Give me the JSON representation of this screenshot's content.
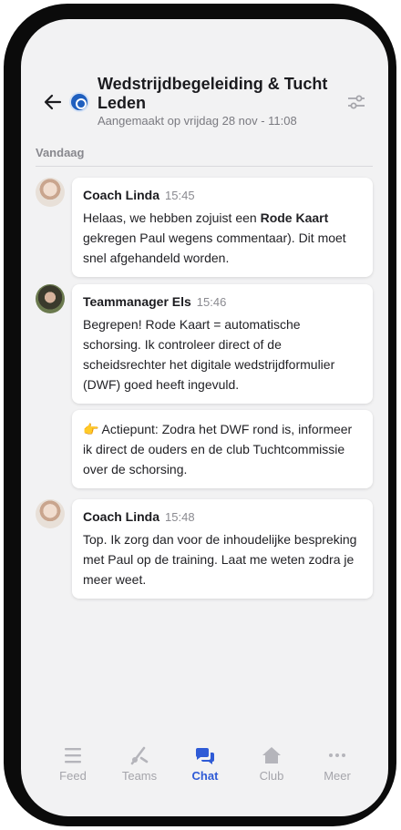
{
  "header": {
    "title": "Wedstrijdbegeleiding & Tucht Leden",
    "subtitle": "Aangemaakt op vrijdag 28 nov - 11:08"
  },
  "day_label": "Vandaag",
  "messages": [
    {
      "author": "Coach Linda",
      "time": "15:45",
      "text_before": "Helaas, we hebben zojuist een ",
      "text_bold": "Rode Kaart",
      "text_after": " gekregen Paul wegens commentaar). Dit moet snel afgehandeld worden."
    },
    {
      "author": "Teammanager Els",
      "time": "15:46",
      "text": "Begrepen! Rode Kaart = automatische schorsing. Ik controleer direct of de scheidsrechter het digitale wedstrijdformulier (DWF) goed heeft ingevuld."
    },
    {
      "text": "👉 Actiepunt: Zodra het DWF rond is, informeer ik direct de ouders en de club Tuchtcommissie over de schorsing."
    },
    {
      "author": "Coach Linda",
      "time": "15:48",
      "text": "Top. Ik zorg dan voor de inhoudelijke bespreking met Paul op de training. Laat me weten zodra je meer weet."
    }
  ],
  "tabs": [
    {
      "label": "Feed",
      "icon": "feed-icon"
    },
    {
      "label": "Teams",
      "icon": "whistle-icon"
    },
    {
      "label": "Chat",
      "icon": "chat-bubbles-icon"
    },
    {
      "label": "Club",
      "icon": "home-icon"
    },
    {
      "label": "Meer",
      "icon": "more-dots-icon"
    }
  ],
  "active_tab": "Chat",
  "colors": {
    "accent": "#2f5bd6",
    "inactive": "#a5a5ab",
    "background": "#f2f2f3"
  }
}
